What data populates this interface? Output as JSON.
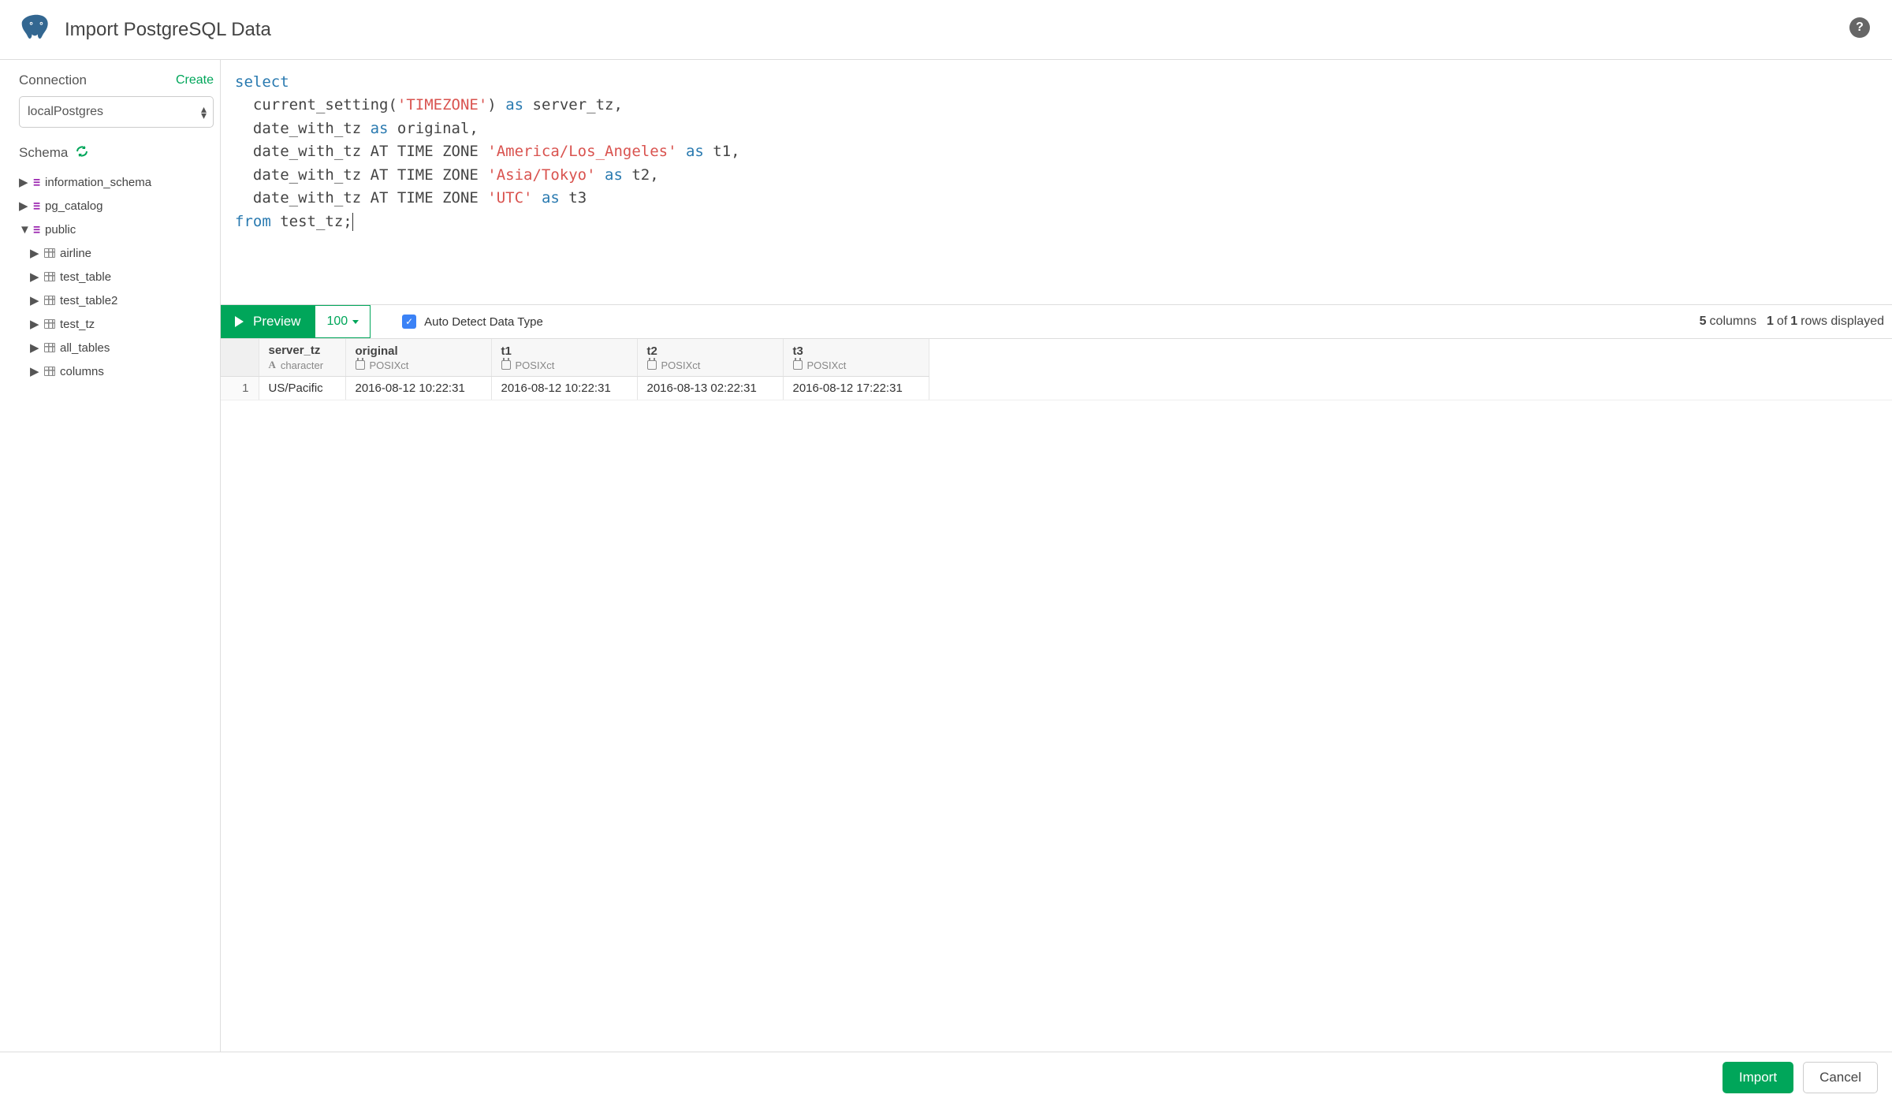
{
  "header": {
    "title": "Import PostgreSQL Data"
  },
  "sidebar": {
    "connection_label": "Connection",
    "create_link": "Create",
    "connection_value": "localPostgres",
    "schema_label": "Schema",
    "schemas": [
      {
        "name": "information_schema",
        "expanded": false
      },
      {
        "name": "pg_catalog",
        "expanded": false
      },
      {
        "name": "public",
        "expanded": true,
        "tables": [
          "airline",
          "test_table",
          "test_table2",
          "test_tz",
          "all_tables",
          "columns"
        ]
      }
    ]
  },
  "editor": {
    "tokens": [
      {
        "t": "select",
        "c": "kw"
      },
      {
        "t": "\n  current_setting("
      },
      {
        "t": "'TIMEZONE'",
        "c": "str"
      },
      {
        "t": ") "
      },
      {
        "t": "as",
        "c": "kw"
      },
      {
        "t": " server_tz,\n  date_with_tz "
      },
      {
        "t": "as",
        "c": "kw"
      },
      {
        "t": " original,\n  date_with_tz AT TIME ZONE "
      },
      {
        "t": "'America/Los_Angeles'",
        "c": "str"
      },
      {
        "t": " "
      },
      {
        "t": "as",
        "c": "kw"
      },
      {
        "t": " t1,\n  date_with_tz AT TIME ZONE "
      },
      {
        "t": "'Asia/Tokyo'",
        "c": "str"
      },
      {
        "t": " "
      },
      {
        "t": "as",
        "c": "kw"
      },
      {
        "t": " t2,\n  date_with_tz AT TIME ZONE "
      },
      {
        "t": "'UTC'",
        "c": "str"
      },
      {
        "t": " "
      },
      {
        "t": "as",
        "c": "kw"
      },
      {
        "t": " t3\n"
      },
      {
        "t": "from",
        "c": "kw"
      },
      {
        "t": " test_tz;"
      }
    ]
  },
  "preview": {
    "button_label": "Preview",
    "limit": "100",
    "auto_detect_label": "Auto Detect Data Type",
    "auto_detect_checked": true,
    "status": {
      "cols": "5",
      "cols_word": "columns",
      "sep": " ",
      "row_a": "1",
      "of": "of",
      "row_b": "1",
      "tail": "rows displayed"
    }
  },
  "results": {
    "columns": [
      {
        "name": "server_tz",
        "type_icon": "A",
        "type": "character"
      },
      {
        "name": "original",
        "type_icon": "cal",
        "type": "POSIXct"
      },
      {
        "name": "t1",
        "type_icon": "cal",
        "type": "POSIXct"
      },
      {
        "name": "t2",
        "type_icon": "cal",
        "type": "POSIXct"
      },
      {
        "name": "t3",
        "type_icon": "cal",
        "type": "POSIXct"
      }
    ],
    "rows": [
      {
        "n": "1",
        "cells": [
          "US/Pacific",
          "2016-08-12 10:22:31",
          "2016-08-12 10:22:31",
          "2016-08-13 02:22:31",
          "2016-08-12 17:22:31"
        ]
      }
    ]
  },
  "footer": {
    "import": "Import",
    "cancel": "Cancel"
  }
}
